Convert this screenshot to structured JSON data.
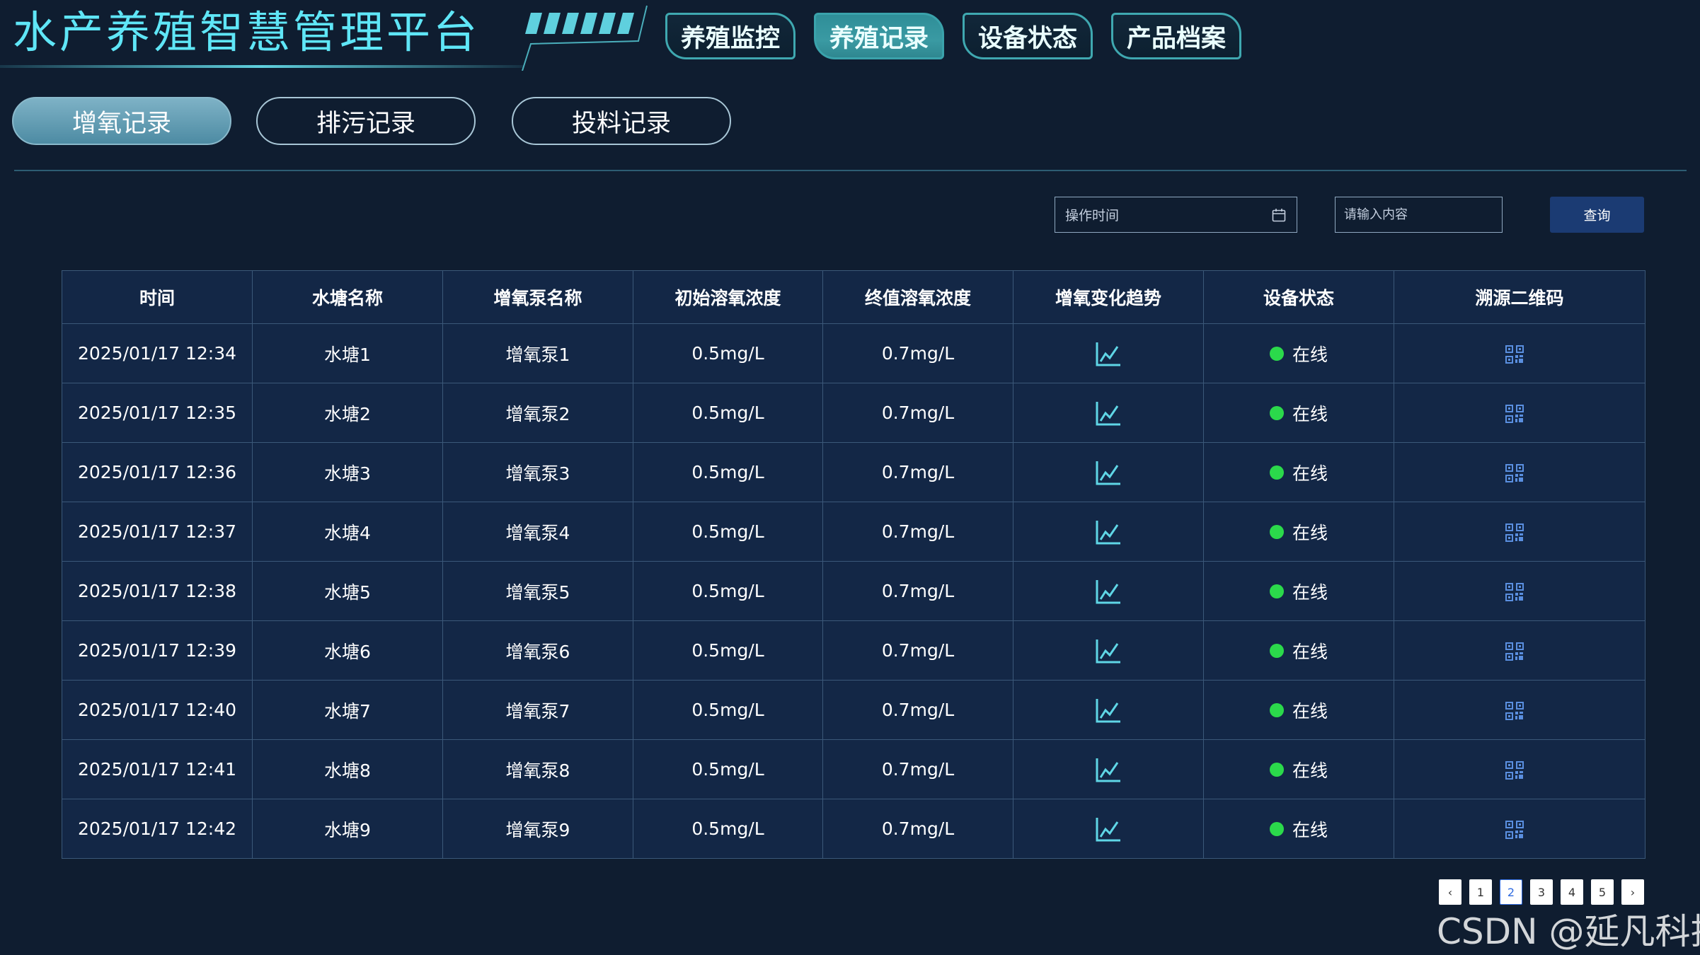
{
  "app": {
    "title": "水产养殖智慧管理平台"
  },
  "nav": {
    "tabs": [
      {
        "label": "养殖监控",
        "active": false
      },
      {
        "label": "养殖记录",
        "active": true
      },
      {
        "label": "设备状态",
        "active": false
      },
      {
        "label": "产品档案",
        "active": false
      }
    ]
  },
  "subtabs": [
    {
      "label": "增氧记录",
      "active": true
    },
    {
      "label": "排污记录",
      "active": false
    },
    {
      "label": "投料记录",
      "active": false
    }
  ],
  "filters": {
    "date_placeholder": "操作时间",
    "search_placeholder": "请输入内容",
    "query_label": "查询"
  },
  "table": {
    "headers": [
      "时间",
      "水塘名称",
      "增氧泵名称",
      "初始溶氧浓度",
      "终值溶氧浓度",
      "增氧变化趋势",
      "设备状态",
      "溯源二维码"
    ],
    "rows": [
      {
        "time": "2025/01/17 12:34",
        "pond": "水塘1",
        "pump": "增氧泵1",
        "initial": "0.5mg/L",
        "final": "0.7mg/L",
        "status": "在线"
      },
      {
        "time": "2025/01/17 12:35",
        "pond": "水塘2",
        "pump": "增氧泵2",
        "initial": "0.5mg/L",
        "final": "0.7mg/L",
        "status": "在线"
      },
      {
        "time": "2025/01/17 12:36",
        "pond": "水塘3",
        "pump": "增氧泵3",
        "initial": "0.5mg/L",
        "final": "0.7mg/L",
        "status": "在线"
      },
      {
        "time": "2025/01/17 12:37",
        "pond": "水塘4",
        "pump": "增氧泵4",
        "initial": "0.5mg/L",
        "final": "0.7mg/L",
        "status": "在线"
      },
      {
        "time": "2025/01/17 12:38",
        "pond": "水塘5",
        "pump": "增氧泵5",
        "initial": "0.5mg/L",
        "final": "0.7mg/L",
        "status": "在线"
      },
      {
        "time": "2025/01/17 12:39",
        "pond": "水塘6",
        "pump": "增氧泵6",
        "initial": "0.5mg/L",
        "final": "0.7mg/L",
        "status": "在线"
      },
      {
        "time": "2025/01/17 12:40",
        "pond": "水塘7",
        "pump": "增氧泵7",
        "initial": "0.5mg/L",
        "final": "0.7mg/L",
        "status": "在线"
      },
      {
        "time": "2025/01/17 12:41",
        "pond": "水塘8",
        "pump": "增氧泵8",
        "initial": "0.5mg/L",
        "final": "0.7mg/L",
        "status": "在线"
      },
      {
        "time": "2025/01/17 12:42",
        "pond": "水塘9",
        "pump": "增氧泵9",
        "initial": "0.5mg/L",
        "final": "0.7mg/L",
        "status": "在线"
      }
    ]
  },
  "pagination": {
    "prev": "‹",
    "next": "›",
    "pages": [
      "1",
      "2",
      "3",
      "4",
      "5"
    ],
    "current": "2"
  },
  "watermark": "CSDN @延凡科技",
  "icons": {
    "trend": "line-chart-icon",
    "qr": "qr-code-icon",
    "calendar": "calendar-icon",
    "status": "status-dot"
  },
  "colors": {
    "title": "#5fe6f7",
    "accent": "#3fa8b0",
    "online": "#2bd94b",
    "query_button": "#1b3b73"
  }
}
